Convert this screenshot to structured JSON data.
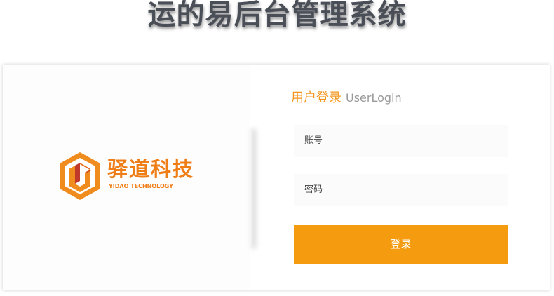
{
  "page_title": "运的易后台管理系统",
  "brand": {
    "name_cn": "驿道科技",
    "name_en": "YIDAO TECHNOLOGY",
    "color": "#f07e17",
    "logo_icon": "hexagon-logo-icon"
  },
  "login": {
    "heading_cn": "用户登录",
    "heading_en": "UserLogin",
    "account_label": "账号",
    "account_value": "",
    "password_label": "密码",
    "password_value": "",
    "submit_label": "登录"
  },
  "colors": {
    "accent": "#f59b0f",
    "title_text": "#4a4e57"
  }
}
